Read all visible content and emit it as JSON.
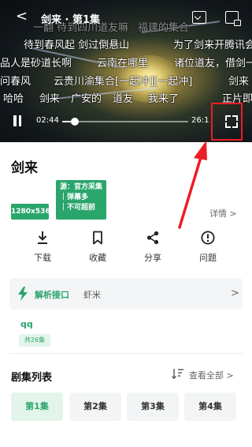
{
  "player": {
    "back_glyph": "<",
    "title": "剑来 · 第1集",
    "danmaku": [
      "一翻 待到四川道友嘛",
      "福建的集合",
      "待到春风起 剑过倒悬山",
      "为了剑来开腾讯会",
      "品人是砂道长啊",
      "云南在哪里",
      "诸位道友，借剑一",
      "问春风",
      "云贵川渝集合[一起冲][一起冲]",
      "剑来",
      "哈哈",
      "剑来",
      "广安的",
      "道友",
      "我来了",
      "正片即"
    ],
    "current_time": "02:44",
    "total_time": "26:1",
    "progress": 0.1
  },
  "video": {
    "title": "剑来",
    "resolution": "1280x536",
    "source_lines": [
      "源：官方采集",
      "｜弹幕多",
      "｜不可超前"
    ],
    "details_label": "详情 >"
  },
  "actions": [
    {
      "label": "下载",
      "icon": "download-icon"
    },
    {
      "label": "收藏",
      "icon": "bookmark-icon"
    },
    {
      "label": "分享",
      "icon": "share-icon"
    },
    {
      "label": "问题",
      "icon": "alert-icon"
    }
  ],
  "parser": {
    "label": "解析接口",
    "value": "虾米",
    "chevron": ">"
  },
  "source": {
    "name": "qq",
    "count": "共26集"
  },
  "episodes": {
    "title": "剧集列表",
    "view_all": "查看全部 >",
    "items": [
      "第1集",
      "第2集",
      "第3集",
      "第4集"
    ],
    "active_index": 0
  },
  "colors": {
    "accent": "#2aa56b",
    "highlight": "#ee1c24"
  }
}
